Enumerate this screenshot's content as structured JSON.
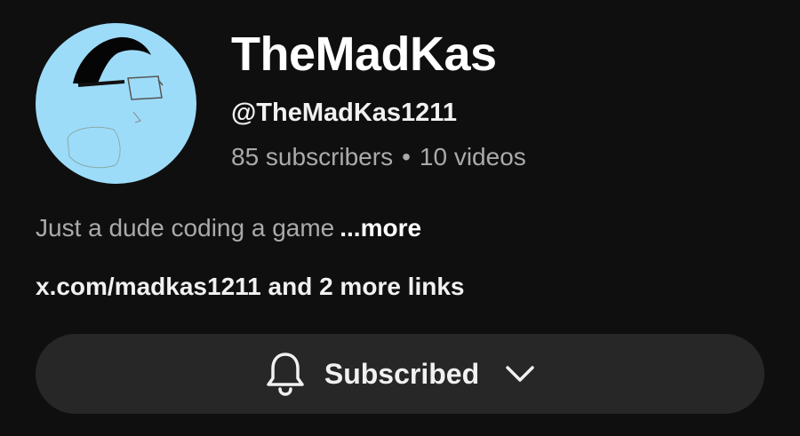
{
  "channel": {
    "name": "TheMadKas",
    "handle": "@TheMadKas1211",
    "subscribers": "85 subscribers",
    "separator": "•",
    "videos": "10 videos",
    "description": "Just a dude coding a game",
    "more_label": "...more",
    "links_text": "x.com/madkas1211 and 2 more links"
  },
  "subscribe_button": {
    "label": "Subscribed",
    "icon": "bell-icon",
    "dropdown_icon": "chevron-down-icon"
  },
  "colors": {
    "background": "#0f0f0f",
    "button_bg": "#272727",
    "avatar_bg": "#9ddcf9",
    "secondary_text": "#aaaaaa"
  }
}
